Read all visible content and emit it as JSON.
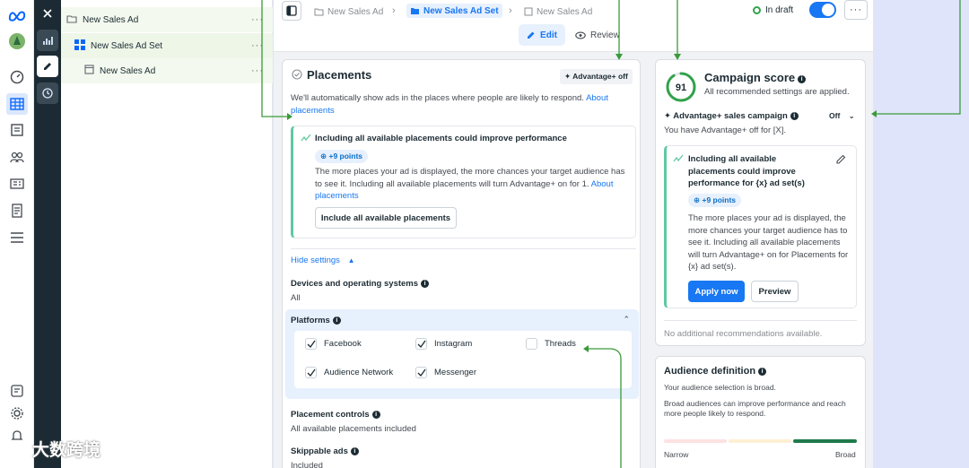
{
  "tree": {
    "campaign": "New Sales Ad",
    "adset": "New Sales Ad Set",
    "ad": "New Sales Ad",
    "more": "···"
  },
  "header": {
    "breadcrumbs": [
      "New Sales Ad",
      "New Sales Ad Set",
      "New Sales Ad"
    ],
    "tab_edit": "Edit",
    "tab_review": "Review",
    "status": "In draft",
    "more": "···"
  },
  "placements": {
    "title": "Placements",
    "advantage_badge": "Advantage+ off",
    "intro": "We'll automatically show ads in the places where people are likely to respond.",
    "intro_link": "About placements",
    "tip_title": "Including all available placements could improve performance",
    "tip_points": "+9 points",
    "tip_body": "The more places your ad is displayed, the more chances your target audience has to see it. Including all available placements will turn Advantage+ on for 1.",
    "tip_link": "About placements",
    "tip_button": "Include all available placements",
    "hide_settings": "Hide settings",
    "devices_label": "Devices and operating systems",
    "devices_value": "All",
    "platforms_label": "Platforms",
    "platforms": [
      {
        "label": "Facebook",
        "checked": true
      },
      {
        "label": "Instagram",
        "checked": true
      },
      {
        "label": "Threads",
        "checked": false
      },
      {
        "label": "Audience Network",
        "checked": true
      },
      {
        "label": "Messenger",
        "checked": true
      }
    ],
    "placement_controls_label": "Placement controls",
    "placement_controls_value": "All available placements included",
    "skippable_label": "Skippable ads",
    "skippable_value": "Included"
  },
  "score": {
    "value": "91",
    "title": "Campaign score",
    "subtitle": "All recommended settings are applied.",
    "advantage_label": "Advantage+ sales campaign",
    "advantage_state": "Off",
    "advantage_note": "You have Advantage+ off for [X].",
    "tip_title": "Including all available placements could improve performance for {x} ad set(s)",
    "tip_points": "+9 points",
    "tip_body": "The more places your ad is displayed, the more chances your target audience has to see it. Including all available placements will turn Advantage+ on for Placements for {x} ad set(s).",
    "apply_button": "Apply now",
    "preview_button": "Preview",
    "no_more": "No additional recommendations available."
  },
  "audience": {
    "title": "Audience definition",
    "line1": "Your audience selection is broad.",
    "line2": "Broad audiences can improve performance and reach more people likely to respond.",
    "narrow": "Narrow",
    "broad": "Broad"
  },
  "watermark": "大数跨境",
  "colors": {
    "accent": "#1877f2",
    "tip_border": "#5fc9a1",
    "annotation_line": "#3a9a3a",
    "score_ring": "#31a24c"
  }
}
